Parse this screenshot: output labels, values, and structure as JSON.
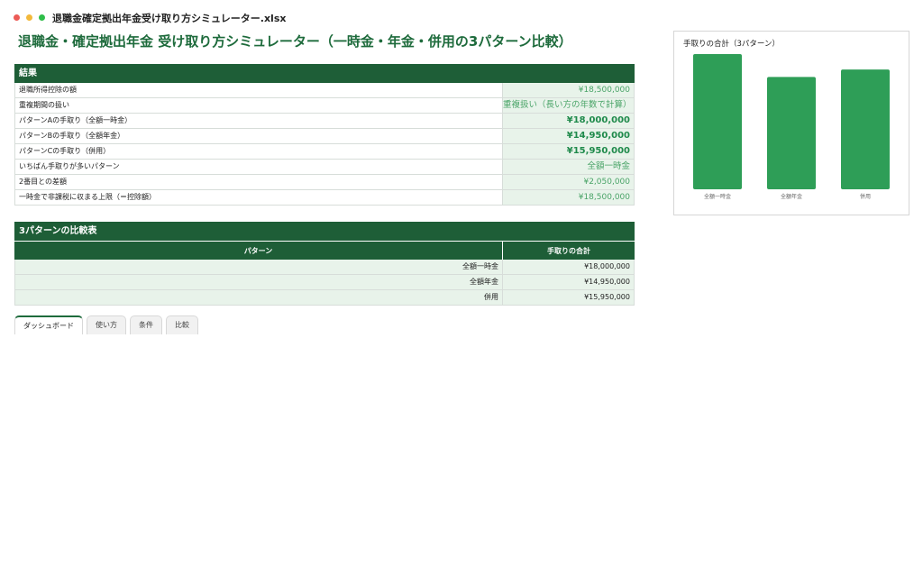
{
  "window": {
    "filename": "退職金確定拠出年金受け取り方シミュレーター.xlsx"
  },
  "page_title": "退職金・確定拠出年金 受け取り方シミュレーター（一時金・年金・併用の3パターン比較）",
  "results": {
    "header": "結果",
    "rows": [
      {
        "label": "退職所得控除の額",
        "value": "¥18,500,000"
      },
      {
        "label": "重複期間の扱い",
        "value": "重複扱い（長い方の年数で計算）"
      },
      {
        "label": "パターンAの手取り（全額一時金）",
        "value": "¥18,000,000"
      },
      {
        "label": "パターンBの手取り（全額年金）",
        "value": "¥14,950,000"
      },
      {
        "label": "パターンCの手取り（併用）",
        "value": "¥15,950,000"
      },
      {
        "label": "いちばん手取りが多いパターン",
        "value": "全額一時金"
      },
      {
        "label": "2番目との差額",
        "value": "¥2,050,000"
      },
      {
        "label": "一時金で非課税に収まる上限（＝控除額）",
        "value": "¥18,500,000"
      }
    ]
  },
  "comparison": {
    "header": "3パターンの比較表",
    "col_pattern": "パターン",
    "col_total": "手取りの合計",
    "rows": [
      {
        "pattern": "全額一時金",
        "total": "¥18,000,000"
      },
      {
        "pattern": "全額年金",
        "total": "¥14,950,000"
      },
      {
        "pattern": "併用",
        "total": "¥15,950,000"
      }
    ]
  },
  "tabs": [
    {
      "label": "ダッシュボード",
      "active": true
    },
    {
      "label": "使い方",
      "active": false
    },
    {
      "label": "条件",
      "active": false
    },
    {
      "label": "比較",
      "active": false
    }
  ],
  "colors": {
    "bar": "#2e9e57",
    "header": "#1e5e37",
    "title": "#1e6b3c"
  },
  "chart_data": {
    "type": "bar",
    "title": "手取りの合計（3パターン）",
    "categories": [
      "全額一時金",
      "全額年金",
      "併用"
    ],
    "values": [
      18000000,
      14950000,
      15950000
    ],
    "ylim": [
      0,
      18000000
    ],
    "grid": false,
    "legend": "none"
  }
}
